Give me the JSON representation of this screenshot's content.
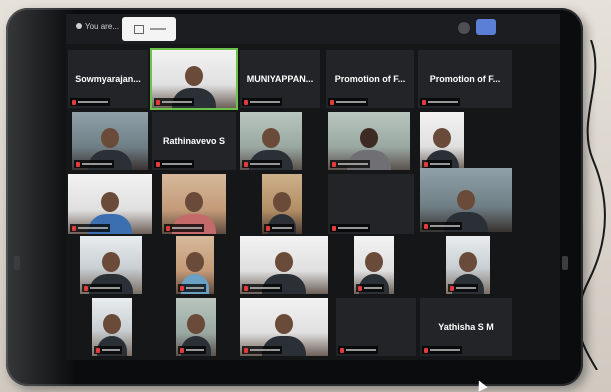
{
  "topbar": {
    "recording_label": "You are..."
  },
  "participants": [
    {
      "name": "Sowmyarajan...",
      "kind": "name"
    },
    {
      "name": "",
      "kind": "video",
      "speaker": true
    },
    {
      "name": "MUNIYAPPAN...",
      "kind": "name"
    },
    {
      "name": "Promotion of F...",
      "kind": "name"
    },
    {
      "name": "Promotion of F...",
      "kind": "name"
    },
    {
      "name": "",
      "kind": "video"
    },
    {
      "name": "Rathinavevo S",
      "kind": "name"
    },
    {
      "name": "",
      "kind": "video"
    },
    {
      "name": "",
      "kind": "video"
    },
    {
      "name": "",
      "kind": "video"
    },
    {
      "name": "",
      "kind": "video"
    },
    {
      "name": "",
      "kind": "video"
    },
    {
      "name": "",
      "kind": "video"
    },
    {
      "name": "",
      "kind": "video"
    },
    {
      "name": "",
      "kind": "video"
    },
    {
      "name": "",
      "kind": "video"
    },
    {
      "name": "",
      "kind": "video"
    },
    {
      "name": "",
      "kind": "video"
    },
    {
      "name": "",
      "kind": "video"
    },
    {
      "name": "",
      "kind": "video"
    },
    {
      "name": "",
      "kind": "video"
    },
    {
      "name": "",
      "kind": "video"
    },
    {
      "name": "",
      "kind": "video"
    },
    {
      "name": "",
      "kind": "video"
    },
    {
      "name": "Yathisha S M",
      "kind": "name"
    }
  ],
  "colors": {
    "speaker_outline": "#6cc24a",
    "mic_muted": "#e23b3b",
    "accent_button": "#5b7fd4"
  }
}
